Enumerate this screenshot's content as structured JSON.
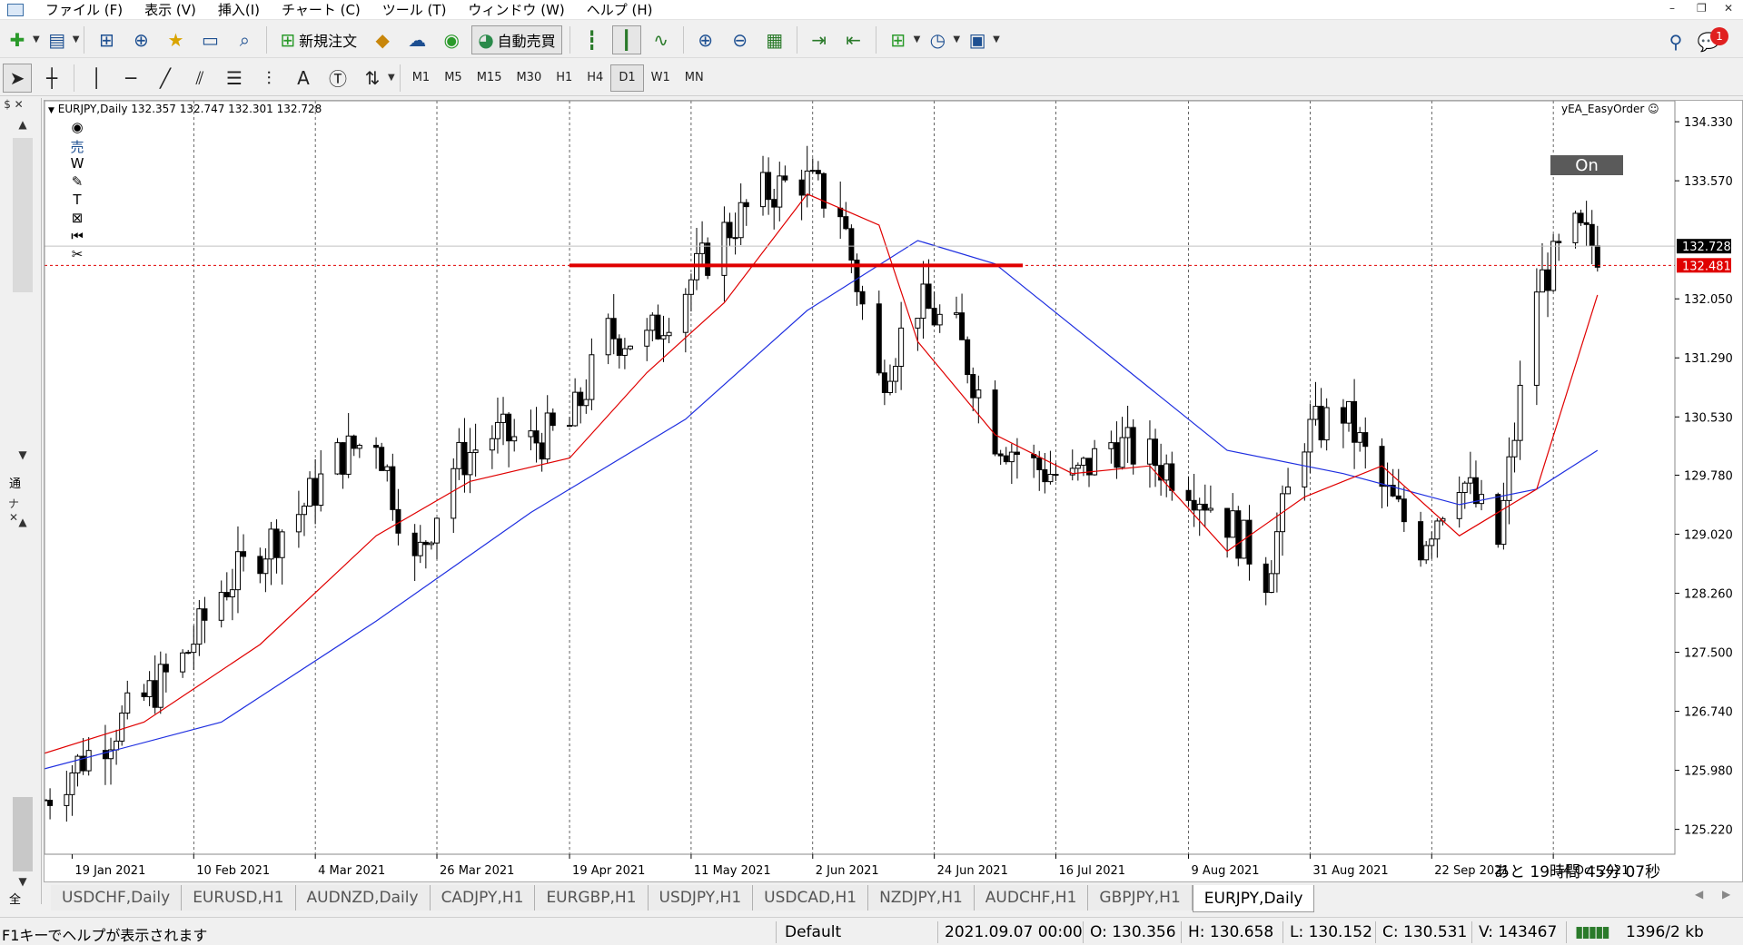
{
  "menu": [
    "ファイル (F)",
    "表示 (V)",
    "挿入(I)",
    "チャート (C)",
    "ツール (T)",
    "ウィンドウ (W)",
    "ヘルプ (H)"
  ],
  "toolbar": {
    "new_order_label": "新規注文",
    "auto_trade_label": "自動売買"
  },
  "timeframes": [
    "M1",
    "M5",
    "M15",
    "M30",
    "H1",
    "H4",
    "D1",
    "W1",
    "MN"
  ],
  "active_timeframe": "D1",
  "chart": {
    "symbol_line": "EURJPY,Daily  132.357 132.747 132.301 132.728",
    "ea_name": "yEA_EasyOrder",
    "on_button_label": "On",
    "bid_label": "132.728",
    "line_label": "132.481",
    "countdown": "あと 19時間  45分 07秒",
    "price_ticks": [
      "134.330",
      "133.570",
      "132.050",
      "131.290",
      "130.530",
      "129.780",
      "129.020",
      "128.260",
      "127.500",
      "126.740",
      "125.980",
      "125.220"
    ],
    "date_ticks": [
      "19 Jan 2021",
      "10 Feb 2021",
      "4 Mar 2021",
      "26 Mar 2021",
      "19 Apr 2021",
      "11 May 2021",
      "2 Jun 2021",
      "24 Jun 2021",
      "16 Jul 2021",
      "9 Aug 2021",
      "31 Aug 2021",
      "22 Sep 2021",
      "14 Oct 2021"
    ],
    "colors": {
      "fast_ma": "#e00000",
      "slow_ma": "#1f2fe0",
      "hline": "#e00000",
      "candle": "#000000"
    }
  },
  "chart_data": {
    "type": "candlestick",
    "symbol": "EURJPY",
    "timeframe": "Daily",
    "ylim": [
      124.9,
      134.6
    ],
    "x_start": "2021-01-14",
    "x_end": "2021-11-05",
    "close_series": {
      "dates": [
        "2021-01-14",
        "2021-01-19",
        "2021-01-25",
        "2021-02-01",
        "2021-02-08",
        "2021-02-15",
        "2021-02-22",
        "2021-03-01",
        "2021-03-08",
        "2021-03-15",
        "2021-03-22",
        "2021-03-29",
        "2021-04-05",
        "2021-04-12",
        "2021-04-19",
        "2021-04-26",
        "2021-05-03",
        "2021-05-10",
        "2021-05-17",
        "2021-05-24",
        "2021-05-31",
        "2021-06-07",
        "2021-06-14",
        "2021-06-21",
        "2021-06-28",
        "2021-07-05",
        "2021-07-12",
        "2021-07-19",
        "2021-07-26",
        "2021-08-02",
        "2021-08-09",
        "2021-08-16",
        "2021-08-23",
        "2021-08-30",
        "2021-09-06",
        "2021-09-13",
        "2021-09-20",
        "2021-09-27",
        "2021-10-04",
        "2021-10-11",
        "2021-10-18",
        "2021-10-22"
      ],
      "values": [
        125.6,
        126.0,
        126.4,
        126.9,
        127.4,
        128.3,
        128.8,
        129.3,
        130.0,
        130.3,
        128.6,
        129.9,
        130.3,
        130.2,
        130.4,
        131.6,
        131.5,
        132.2,
        132.9,
        133.4,
        133.6,
        133.2,
        131.0,
        132.0,
        131.6,
        130.3,
        129.9,
        129.7,
        130.2,
        130.0,
        129.7,
        129.2,
        128.5,
        130.3,
        130.6,
        129.6,
        128.9,
        129.8,
        128.9,
        132.2,
        132.9,
        132.7
      ]
    },
    "fast_ma": {
      "dates": [
        "2021-01-14",
        "2021-02-01",
        "2021-02-22",
        "2021-03-15",
        "2021-04-01",
        "2021-04-19",
        "2021-05-03",
        "2021-05-17",
        "2021-06-01",
        "2021-06-14",
        "2021-06-21",
        "2021-07-05",
        "2021-07-19",
        "2021-08-02",
        "2021-08-16",
        "2021-08-30",
        "2021-09-13",
        "2021-09-27",
        "2021-10-11",
        "2021-10-22"
      ],
      "values": [
        126.2,
        126.6,
        127.6,
        129.0,
        129.7,
        130.0,
        131.1,
        132.0,
        133.4,
        133.0,
        131.5,
        130.3,
        129.8,
        129.9,
        128.8,
        129.5,
        129.9,
        129.0,
        129.6,
        132.1
      ]
    },
    "slow_ma": {
      "dates": [
        "2021-01-14",
        "2021-02-15",
        "2021-03-15",
        "2021-04-12",
        "2021-05-10",
        "2021-06-01",
        "2021-06-21",
        "2021-07-05",
        "2021-07-26",
        "2021-08-16",
        "2021-09-06",
        "2021-09-27",
        "2021-10-11",
        "2021-10-22"
      ],
      "values": [
        126.0,
        126.6,
        127.9,
        129.3,
        130.5,
        131.9,
        132.8,
        132.5,
        131.3,
        130.1,
        129.8,
        129.4,
        129.6,
        130.1
      ]
    },
    "horizontal_line": {
      "price": 132.481,
      "from": "2021-04-19",
      "to": "2021-07-10"
    }
  },
  "tabs": [
    "USDCHF,Daily",
    "EURUSD,H1",
    "AUDNZD,Daily",
    "CADJPY,H1",
    "EURGBP,H1",
    "USDJPY,H1",
    "USDCAD,H1",
    "NZDJPY,H1",
    "AUDCHF,H1",
    "GBPJPY,H1",
    "EURJPY,Daily"
  ],
  "active_tab": "EURJPY,Daily",
  "statusbar": {
    "help": "F1キーでヘルプが表示されます",
    "profile": "Default",
    "datetime": "2021.09.07 00:00",
    "open": "O: 130.356",
    "high": "H: 130.658",
    "low": "L: 130.152",
    "close": "C: 130.531",
    "volume": "V: 143467",
    "traffic": "1396/2 kb"
  },
  "navigator": {
    "tab1": "通",
    "tab2": "全"
  },
  "notification_count": "1"
}
